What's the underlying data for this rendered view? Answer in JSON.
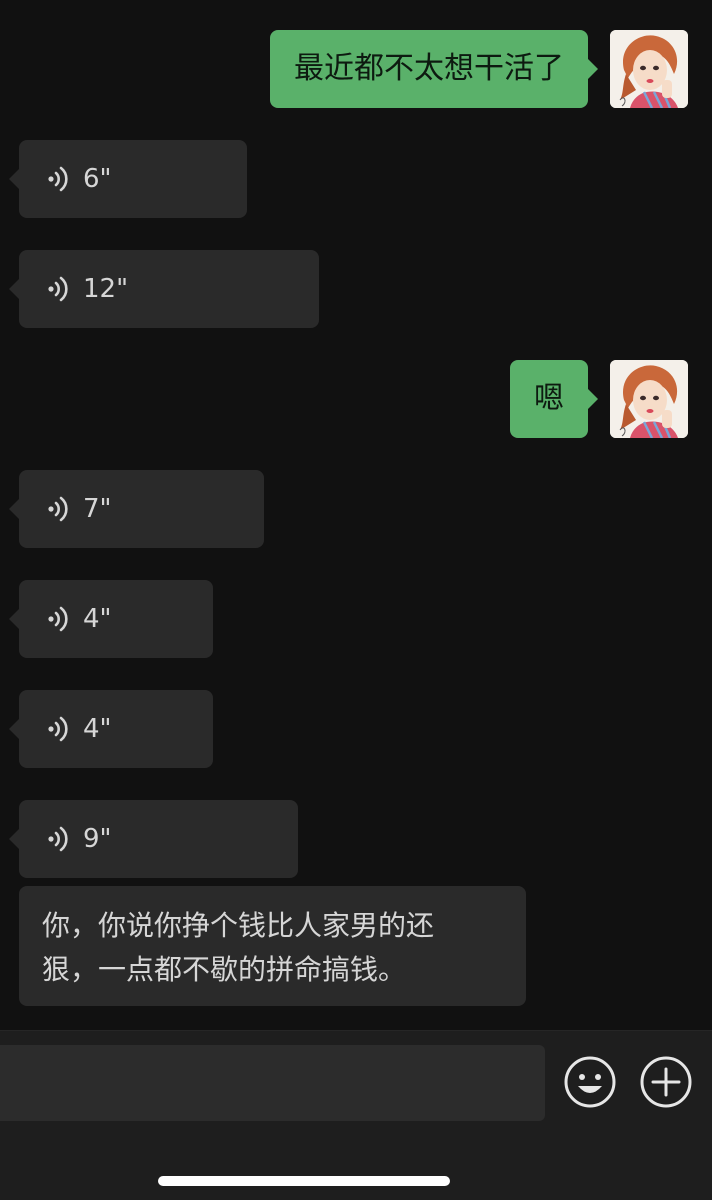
{
  "messages": [
    {
      "type": "text",
      "side": "out",
      "text": "最近都不太想干活了"
    },
    {
      "type": "voice",
      "side": "in",
      "duration": "6\""
    },
    {
      "type": "voice",
      "side": "in",
      "duration": "12\""
    },
    {
      "type": "text",
      "side": "out",
      "text": "嗯"
    },
    {
      "type": "voice",
      "side": "in",
      "duration": "7\""
    },
    {
      "type": "voice",
      "side": "in",
      "duration": "4\""
    },
    {
      "type": "voice",
      "side": "in",
      "duration": "4\""
    },
    {
      "type": "voice",
      "side": "in",
      "duration": "9\""
    },
    {
      "type": "text",
      "side": "in",
      "line1": "你，你说你挣个钱比人家男的还",
      "line2": "狠，一点都不歇的拼命搞钱。"
    }
  ],
  "icons": {
    "voice": "voice-wave-icon",
    "emoji": "emoji-icon",
    "plus": "plus-icon"
  },
  "colors": {
    "background": "#111111",
    "outgoing_bubble": "#5ab16a",
    "incoming_bubble": "#2a2a2a",
    "input_bar": "#1e1e1e"
  }
}
